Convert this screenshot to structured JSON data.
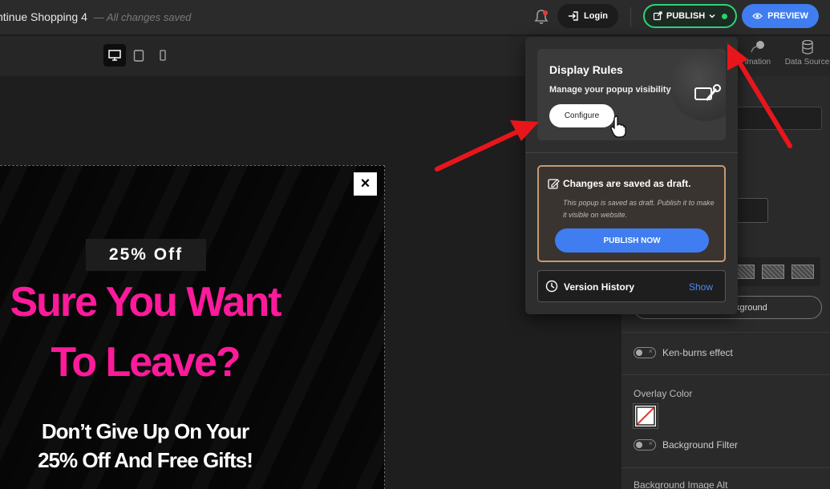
{
  "header": {
    "doc_title": "ntinue Shopping 4",
    "doc_status": "— All changes saved",
    "login_label": "Login",
    "publish_label": "PUBLISH",
    "preview_label": "PREVIEW"
  },
  "right_tabs": {
    "animation": "imation",
    "data_source": "Data Source"
  },
  "dropdown": {
    "rules_title": "Display Rules",
    "rules_subtitle": "Manage your popup visibility",
    "configure_label": "Configure",
    "draft_title": "Changes are saved as draft.",
    "draft_desc": "This popup is saved as draft. Publish it to make it visible on website.",
    "publish_now_label": "PUBLISH NOW",
    "version_title": "Version History",
    "version_show": "Show"
  },
  "popup": {
    "close": "×",
    "offer": "25% Off",
    "headline_line1": "Sure You Want",
    "headline_line2": "To Leave?",
    "sub_line1": "Don’t Give Up On Your",
    "sub_line2": "25% Off And Free Gifts!"
  },
  "settings": {
    "background_btn": "kground",
    "ken_burns": "Ken-burns effect",
    "overlay_color": "Overlay Color",
    "background_filter": "Background Filter",
    "bg_image_alt": "Background Image Alt"
  },
  "colors": {
    "accent_blue": "#3f7df0",
    "publish_green": "#2fd27a",
    "headline_pink": "#ff1a9b",
    "annotation_red": "#e8161c"
  }
}
